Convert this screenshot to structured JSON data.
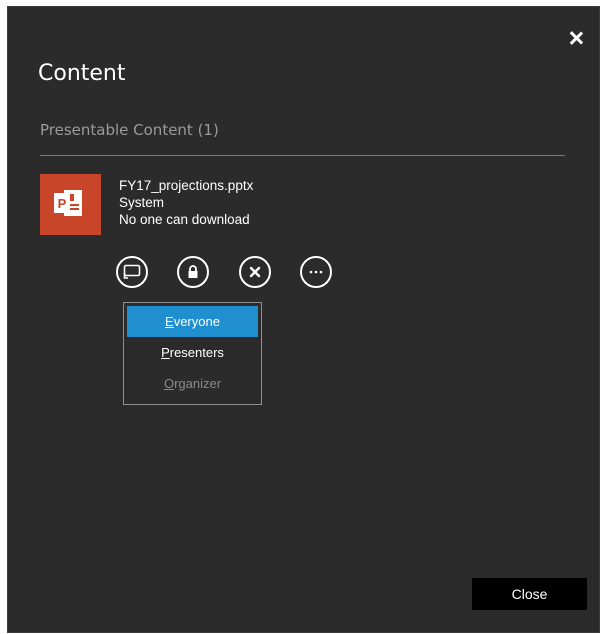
{
  "dialog": {
    "title": "Content",
    "close_icon": "close-icon"
  },
  "section": {
    "header": "Presentable Content (1)"
  },
  "file": {
    "icon": "powerpoint-icon",
    "name": "FY17_projections.pptx",
    "owner": "System",
    "download_status": "No one can download"
  },
  "actions": [
    {
      "icon": "present-screen-icon"
    },
    {
      "icon": "lock-icon"
    },
    {
      "icon": "remove-icon"
    },
    {
      "icon": "more-options-icon"
    }
  ],
  "menu": {
    "items": [
      {
        "mnemonic": "E",
        "rest": "veryone",
        "state": "selected"
      },
      {
        "mnemonic": "P",
        "rest": "resenters",
        "state": "normal"
      },
      {
        "mnemonic": "O",
        "rest": "rganizer",
        "state": "disabled"
      }
    ]
  },
  "footer": {
    "close_label": "Close"
  },
  "colors": {
    "background": "#2b2b2b",
    "accent": "#1f8fcf",
    "file_tile": "#c8452a"
  }
}
